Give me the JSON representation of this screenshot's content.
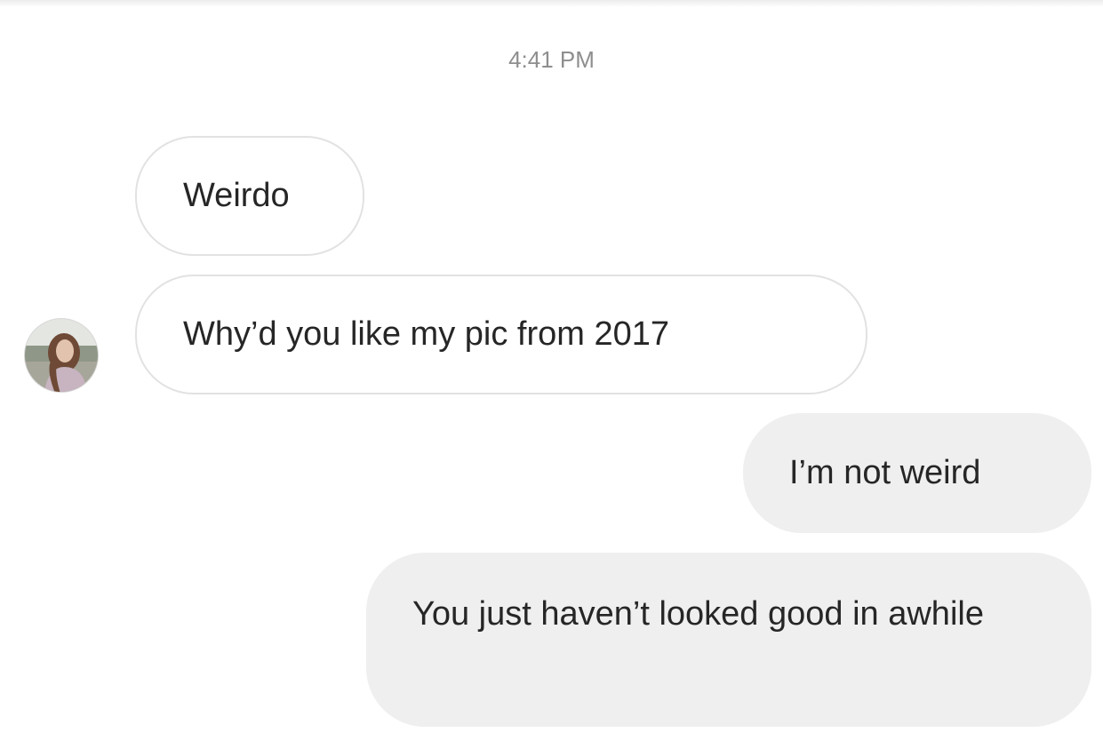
{
  "conversation": {
    "timestamp": "4:41 PM",
    "messages": [
      {
        "sender": "them",
        "text": "Weirdo"
      },
      {
        "sender": "them",
        "text": "Why’d you like my pic from 2017"
      },
      {
        "sender": "me",
        "text": "I’m not weird"
      },
      {
        "sender": "me",
        "text": "You just haven’t looked good in awhile"
      }
    ]
  },
  "avatar": {
    "icon": "contact-photo-avatar"
  },
  "colors": {
    "incoming_bubble_bg": "#ffffff",
    "incoming_bubble_border": "#e2e2e2",
    "outgoing_bubble_bg": "#efefef",
    "timestamp_text": "#8e8e8e",
    "message_text": "#262626"
  }
}
